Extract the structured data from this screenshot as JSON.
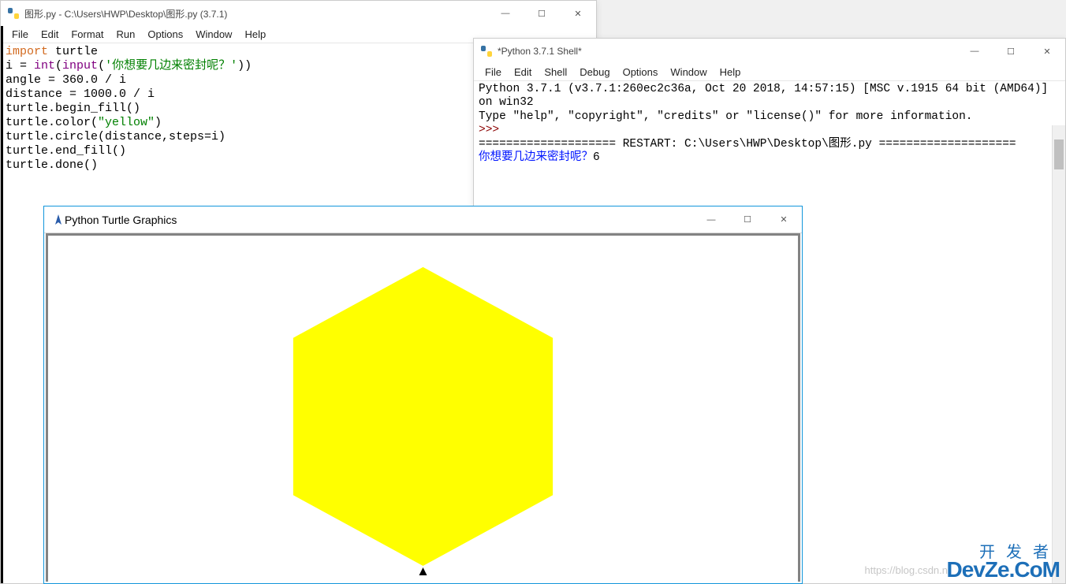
{
  "editor": {
    "title": "图形.py - C:\\Users\\HWP\\Desktop\\图形.py (3.7.1)",
    "menus": [
      "File",
      "Edit",
      "Format",
      "Run",
      "Options",
      "Window",
      "Help"
    ],
    "code": {
      "l1a": "import",
      "l1b": " turtle",
      "l2a": "i = ",
      "l2b": "int",
      "l2c": "(",
      "l2d": "input",
      "l2e": "(",
      "l2f": "'你想要几边来密封呢？'",
      "l2g": "))",
      "l3": "angle = 360.0 / i",
      "l4": "distance = 1000.0 / i",
      "l5": "turtle.begin_fill()",
      "l6a": "turtle.color(",
      "l6b": "\"yellow\"",
      "l6c": ")",
      "l7": "turtle.circle(distance,steps=i)",
      "l8": "turtle.end_fill()",
      "l9": "turtle.done()"
    }
  },
  "shell": {
    "title": "*Python 3.7.1 Shell*",
    "menus": [
      "File",
      "Edit",
      "Shell",
      "Debug",
      "Options",
      "Window",
      "Help"
    ],
    "banner1": "Python 3.7.1 (v3.7.1:260ec2c36a, Oct 20 2018, 14:57:15) [MSC v.1915 64 bit (AMD64)] on win32",
    "banner2": "Type \"help\", \"copyright\", \"credits\" or \"license()\" for more information.",
    "prompt": ">>> ",
    "restart": "==================== RESTART: C:\\Users\\HWP\\Desktop\\图形.py ====================",
    "input_prompt": "你想要几边来密封呢？",
    "input_value": "6"
  },
  "turtle": {
    "title": "Python Turtle Graphics"
  },
  "watermark": {
    "cn": "开发者",
    "en": "DevZe.CoM",
    "sub": "https://blog.csdn.n"
  },
  "win_controls": {
    "min": "—",
    "max": "☐",
    "close": "✕"
  }
}
